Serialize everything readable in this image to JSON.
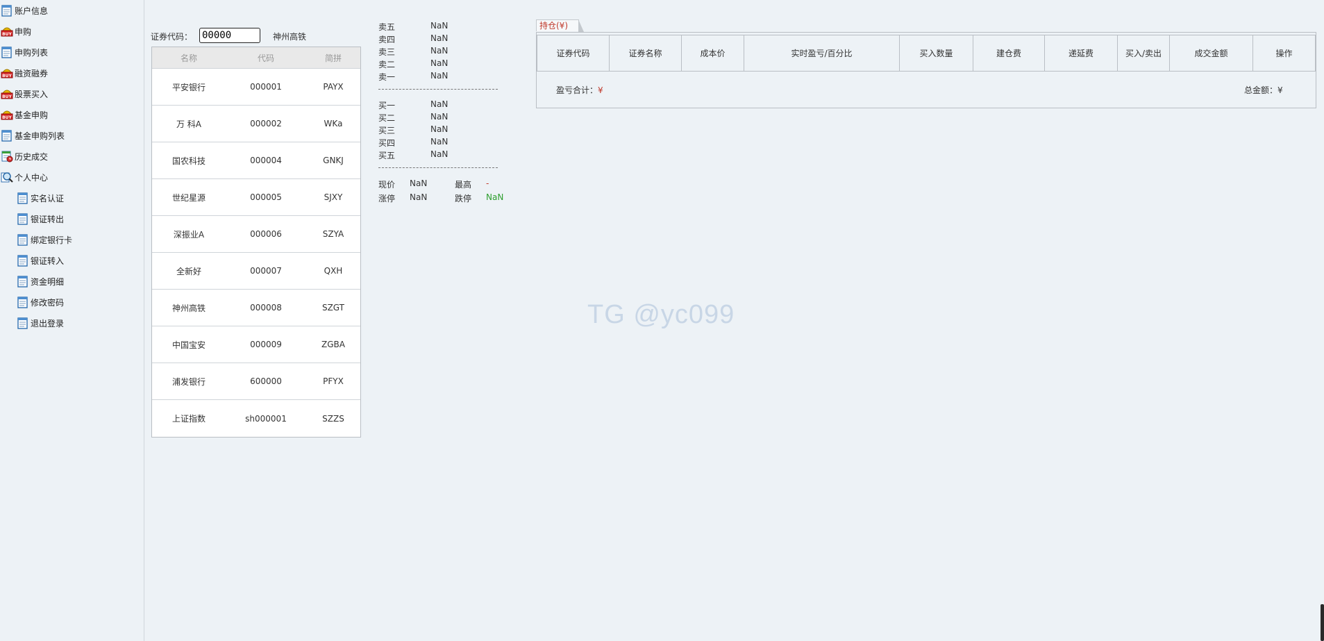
{
  "sidebar": {
    "items": [
      {
        "label": "账户信息",
        "icon": "document-icon"
      },
      {
        "label": "申购",
        "icon": "buy-icon"
      },
      {
        "label": "申购列表",
        "icon": "document-icon"
      },
      {
        "label": "融资融券",
        "icon": "buy-icon"
      },
      {
        "label": "股票买入",
        "icon": "buy-icon"
      },
      {
        "label": "基金申购",
        "icon": "buy-icon"
      },
      {
        "label": "基金申购列表",
        "icon": "document-icon"
      },
      {
        "label": "历史成交",
        "icon": "history-icon"
      },
      {
        "label": "个人中心",
        "icon": "magnifier-icon"
      },
      {
        "label": "实名认证",
        "icon": "document-icon"
      },
      {
        "label": "银证转出",
        "icon": "document-icon"
      },
      {
        "label": "绑定银行卡",
        "icon": "document-icon"
      },
      {
        "label": "银证转入",
        "icon": "document-icon"
      },
      {
        "label": "资金明细",
        "icon": "document-icon"
      },
      {
        "label": "修改密码",
        "icon": "document-icon"
      },
      {
        "label": "退出登录",
        "icon": "document-icon"
      }
    ]
  },
  "search": {
    "label": "证券代码：",
    "value": "00000",
    "result_name": "神州高铁"
  },
  "stock_list": {
    "headers": [
      "名称",
      "代码",
      "简拼"
    ],
    "rows": [
      [
        "平安银行",
        "000001",
        "PAYX"
      ],
      [
        "万 科A",
        "000002",
        "WKa"
      ],
      [
        "国农科技",
        "000004",
        "GNKJ"
      ],
      [
        "世纪星源",
        "000005",
        "SJXY"
      ],
      [
        "深振业A",
        "000006",
        "SZYA"
      ],
      [
        "全新好",
        "000007",
        "QXH"
      ],
      [
        "神州高铁",
        "000008",
        "SZGT"
      ],
      [
        "中国宝安",
        "000009",
        "ZGBA"
      ],
      [
        "浦发银行",
        "600000",
        "PFYX"
      ],
      [
        "上证指数",
        "sh000001",
        "SZZS"
      ]
    ]
  },
  "quote": {
    "sell": [
      {
        "label": "卖五",
        "value": "NaN"
      },
      {
        "label": "卖四",
        "value": "NaN"
      },
      {
        "label": "卖三",
        "value": "NaN"
      },
      {
        "label": "卖二",
        "value": "NaN"
      },
      {
        "label": "卖一",
        "value": "NaN"
      }
    ],
    "buy": [
      {
        "label": "买一",
        "value": "NaN"
      },
      {
        "label": "买二",
        "value": "NaN"
      },
      {
        "label": "买三",
        "value": "NaN"
      },
      {
        "label": "买四",
        "value": "NaN"
      },
      {
        "label": "买五",
        "value": "NaN"
      }
    ],
    "current_label": "现价",
    "current_value": "NaN",
    "high_label": "最高",
    "high_value": "-",
    "limit_up_label": "涨停",
    "limit_up_value": "NaN",
    "limit_down_label": "跌停",
    "limit_down_value": "NaN"
  },
  "positions": {
    "tab_label": "持仓(¥)",
    "headers": [
      "证券代码",
      "证券名称",
      "成本价",
      "实时盈亏/百分比",
      "买入数量",
      "建仓费",
      "递延费",
      "买入/卖出",
      "成交金额",
      "操作"
    ],
    "pl_label": "盈亏合计：",
    "pl_value": "¥",
    "total_label": "总金额：¥"
  },
  "watermark": "TG @yc099",
  "colors": {
    "background": "#edf2f6",
    "red": "#c0392b",
    "green": "#2e9e2e"
  }
}
